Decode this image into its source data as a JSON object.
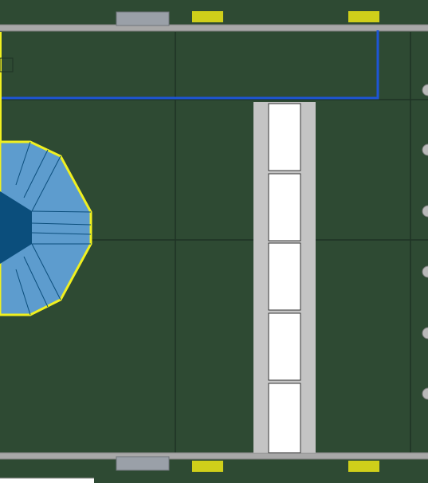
{
  "colors": {
    "floor": "#2e4a33",
    "floor_line": "#1f3324",
    "rail": "#a8a8a8",
    "rail_edge": "#7d7d7d",
    "walkway": "#c4c4c4",
    "table": "#ffffff",
    "yellow_fixture": "#cfcf1a",
    "gray_fixture": "#9aa0a8",
    "blue_route": "#1d55d6",
    "yellow_outline": "#f0f020",
    "booth_light": "#5d9cce",
    "booth_dark": "#0b4e7c",
    "post": "#b9b9b9"
  },
  "icons": {
    "booth": "octagonal-booth-icon",
    "fixture": "rect-fixture-icon",
    "post": "wall-post-icon"
  }
}
